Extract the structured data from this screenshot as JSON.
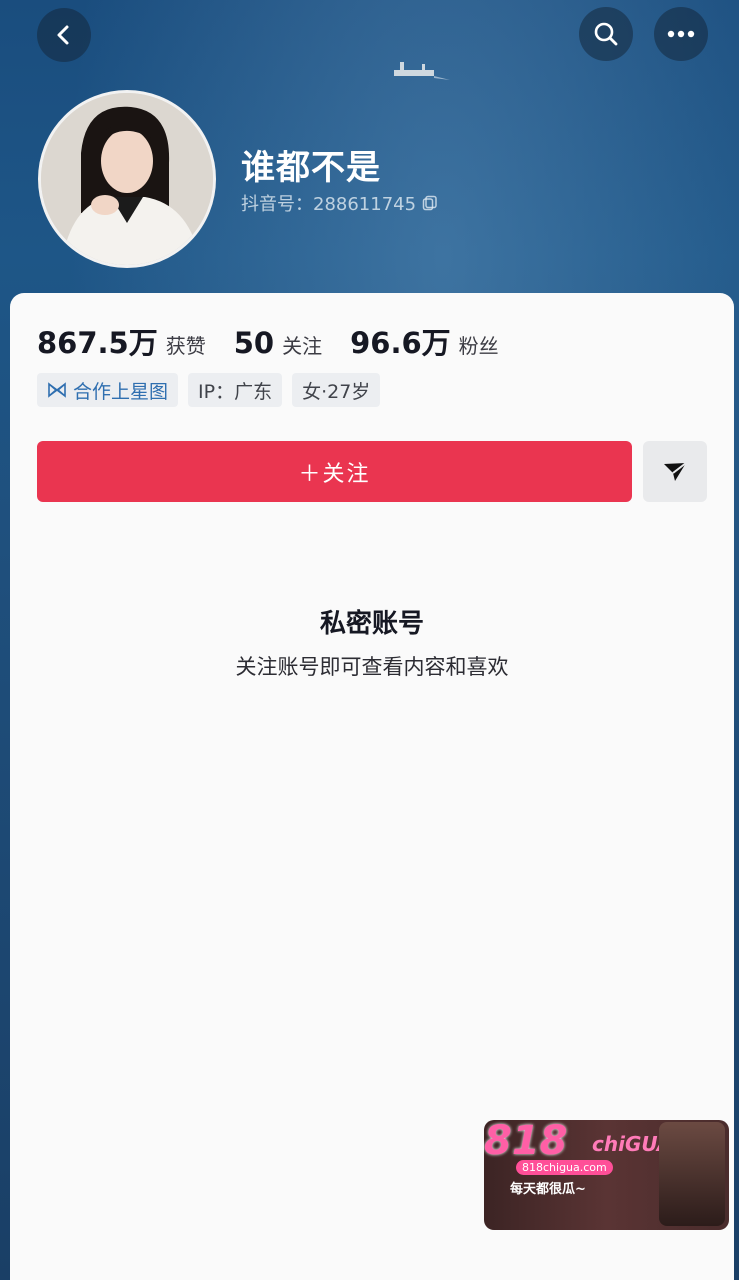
{
  "profile": {
    "name": "谁都不是",
    "douyin_id": "抖音号：288611745"
  },
  "stats": [
    {
      "value": "867.5万",
      "label": "获赞"
    },
    {
      "value": "50",
      "label": "关注"
    },
    {
      "value": "96.6万",
      "label": "粉丝"
    }
  ],
  "tags": {
    "star": "合作上星图",
    "ip": "IP：广东",
    "gender_age": "女·27岁"
  },
  "actions": {
    "follow": "＋关注"
  },
  "private": {
    "title": "私密账号",
    "description": "关注账号即可查看内容和喜欢"
  },
  "watermark": {
    "logo": "818",
    "logo_sub": "chiGUA",
    "url": "818chigua.com",
    "slogan": "每天都很瓜~"
  },
  "colors": {
    "follow_bg": "#ea3550",
    "header_blue": "#1e5687"
  }
}
